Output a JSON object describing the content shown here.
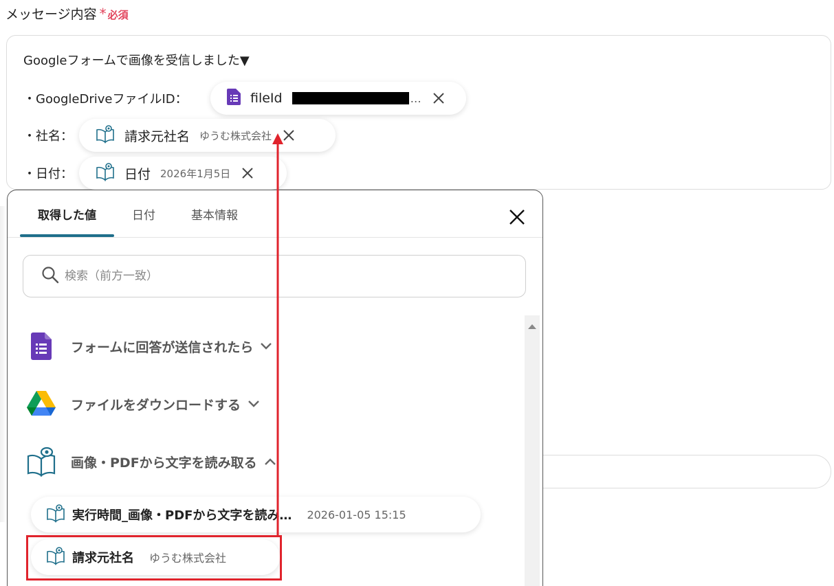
{
  "field": {
    "label": "メッセージ内容",
    "required_star": "*",
    "required_text": "必須"
  },
  "message": {
    "line1": "Googleフォームで画像を受信しました▼",
    "line2": "・GoogleDriveファイルID：",
    "line3": "・社名：",
    "line4": "・日付："
  },
  "chips": {
    "fileid": {
      "label": "fileId",
      "value": "…",
      "icon": "google-forms-icon"
    },
    "company": {
      "label": "請求元社名",
      "value": "ゆうむ株式会社",
      "icon": "ocr-book-icon"
    },
    "date": {
      "label": "日付",
      "value": "2026年1月5日",
      "icon": "ocr-book-icon"
    }
  },
  "picker": {
    "tabs": [
      "取得した値",
      "日付",
      "基本情報"
    ],
    "active_tab": "取得した値",
    "search_placeholder": "検索（前方一致）",
    "sections": [
      {
        "label": "フォームに回答が送信されたら",
        "icon": "google-forms-icon",
        "state": "collapsed"
      },
      {
        "label": "ファイルをダウンロードする",
        "icon": "google-drive-icon",
        "state": "collapsed"
      },
      {
        "label": "画像・PDFから文字を読み取る",
        "icon": "ocr-book-icon",
        "state": "expanded"
      }
    ],
    "items": [
      {
        "label": "実行時間_画像・PDFから文字を読み…",
        "value": "2026-01-05 15:15"
      },
      {
        "label": "請求元社名",
        "value": "ゆうむ株式会社"
      }
    ]
  },
  "colors": {
    "accent": "#1f6f8b",
    "required": "#e2445c",
    "highlight": "#e0232c",
    "forms_purple": "#673ab7"
  }
}
